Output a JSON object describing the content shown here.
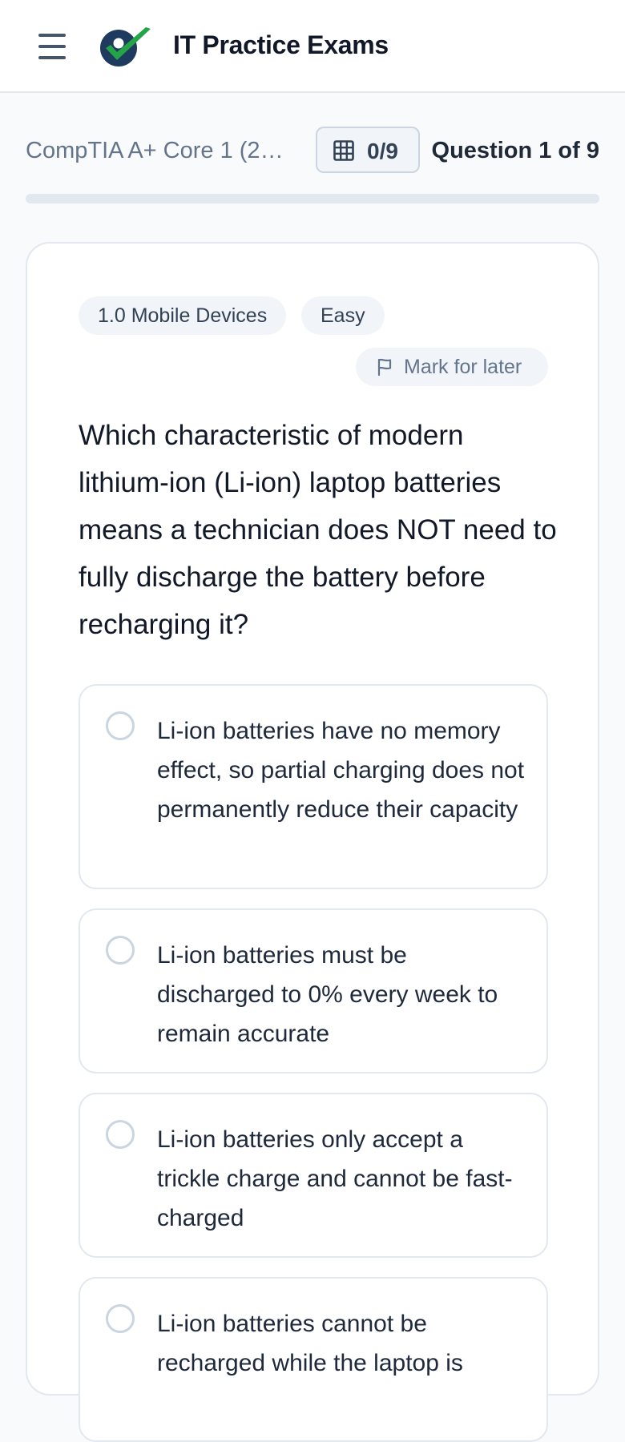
{
  "header": {
    "menu_icon": "hamburger-menu-icon",
    "logo_icon": "checkmark-person-logo-icon",
    "title": "IT Practice Exams"
  },
  "exam": {
    "name": "CompTIA A+ Core 1 (22...",
    "grid_icon": "grid-icon",
    "answered_count": "0/9",
    "question_counter": "Question 1 of 9",
    "progress_fraction": 0
  },
  "question": {
    "domain_badge": "1.0 Mobile Devices",
    "difficulty_badge": "Easy",
    "mark_icon": "flag-icon",
    "mark_label": "Mark for later",
    "text": "Which characteristic of modern lithium-ion (Li-ion) laptop batteries means a technician does NOT need to fully discharge the battery before recharging it?",
    "options": [
      {
        "text": "Li-ion batteries have no memory effect, so partial charging does not permanently reduce their capacity"
      },
      {
        "text": "Li-ion batteries must be discharged to 0% every week to remain accurate"
      },
      {
        "text": "Li-ion batteries only accept a trickle charge and cannot be fast-charged"
      },
      {
        "text": "Li-ion batteries cannot be recharged while the laptop is"
      }
    ]
  },
  "colors": {
    "accent": "#2563eb",
    "logo_dark": "#1e3a5f",
    "logo_green": "#22a447"
  }
}
